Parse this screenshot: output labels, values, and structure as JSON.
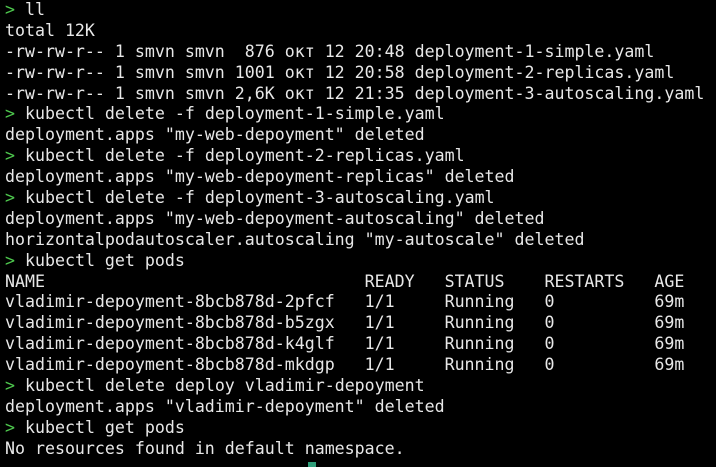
{
  "terminal": {
    "prompt_symbol": ">",
    "cursor_color": "#2f9e7a",
    "lines": [
      {
        "type": "cmd",
        "text": "ll"
      },
      {
        "type": "out",
        "text": "total 12K"
      },
      {
        "type": "out",
        "text": "-rw-rw-r-- 1 smvn smvn  876 окт 12 20:48 deployment-1-simple.yaml"
      },
      {
        "type": "out",
        "text": "-rw-rw-r-- 1 smvn smvn 1001 окт 12 20:58 deployment-2-replicas.yaml"
      },
      {
        "type": "out",
        "text": "-rw-rw-r-- 1 smvn smvn 2,6K окт 12 21:35 deployment-3-autoscaling.yaml"
      },
      {
        "type": "cmd",
        "text": "kubectl delete -f deployment-1-simple.yaml"
      },
      {
        "type": "out",
        "text": "deployment.apps \"my-web-depoyment\" deleted"
      },
      {
        "type": "cmd",
        "text": "kubectl delete -f deployment-2-replicas.yaml"
      },
      {
        "type": "out",
        "text": "deployment.apps \"my-web-depoyment-replicas\" deleted"
      },
      {
        "type": "cmd",
        "text": "kubectl delete -f deployment-3-autoscaling.yaml"
      },
      {
        "type": "out",
        "text": "deployment.apps \"my-web-depoyment-autoscaling\" deleted"
      },
      {
        "type": "out",
        "text": "horizontalpodautoscaler.autoscaling \"my-autoscale\" deleted"
      },
      {
        "type": "cmd",
        "text": "kubectl get pods"
      },
      {
        "type": "out",
        "text": "NAME                                READY   STATUS    RESTARTS   AGE"
      },
      {
        "type": "out",
        "text": "vladimir-depoyment-8bcb878d-2pfcf   1/1     Running   0          69m"
      },
      {
        "type": "out",
        "text": "vladimir-depoyment-8bcb878d-b5zgx   1/1     Running   0          69m"
      },
      {
        "type": "out",
        "text": "vladimir-depoyment-8bcb878d-k4glf   1/1     Running   0          69m"
      },
      {
        "type": "out",
        "text": "vladimir-depoyment-8bcb878d-mkdgp   1/1     Running   0          69m"
      },
      {
        "type": "cmd",
        "text": "kubectl delete deploy vladimir-depoyment"
      },
      {
        "type": "out",
        "text": "deployment.apps \"vladimir-depoyment\" deleted"
      },
      {
        "type": "cmd",
        "text": "kubectl get pods"
      },
      {
        "type": "out",
        "text": "No resources found in default namespace."
      }
    ]
  }
}
